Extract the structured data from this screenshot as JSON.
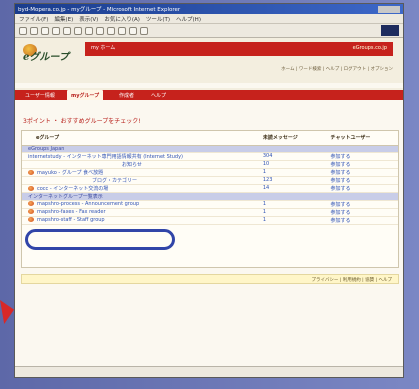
{
  "window": {
    "title": "byd-Mopera.co.jp - myグループ - Microsoft Internet Explorer"
  },
  "menu": [
    "ファイル(F)",
    "編集(E)",
    "表示(V)",
    "お気に入り(A)",
    "ツール(T)",
    "ヘルプ(H)"
  ],
  "header": {
    "logo_text": "eグループ",
    "banner_title": "my ホーム",
    "banner_right": "eGroups.co.jp",
    "crumbs": "ホーム | ワード検索 | ヘルプ | ログアウト | オプション"
  },
  "tabs": [
    "ユーザー情報",
    "myグループ",
    "作成者",
    "ヘルプ"
  ],
  "section": {
    "title": "3ポイント ・ おすすめグループをチェック!",
    "hint": ""
  },
  "table": {
    "headers": [
      "eグループ",
      "未読メッセージ",
      "チャットユーザー"
    ],
    "rows": [
      {
        "type": "group",
        "name": "eGroups Japan",
        "unread": "",
        "chat": ""
      },
      {
        "type": "row",
        "name": "internetstudy - インターネット専門用語情報共有 (Internet Study)",
        "unread": "304",
        "chat": "参加する"
      },
      {
        "type": "row",
        "name": "お知らせ",
        "unread": "10",
        "chat": "参加する"
      },
      {
        "type": "row",
        "name": "mayuko - グループ 食べ放題",
        "unread": "1",
        "chat": "参加する"
      },
      {
        "type": "row",
        "name": "ブログ・カテゴリー",
        "unread": "123",
        "chat": "参加する"
      },
      {
        "type": "row",
        "name": "cocc - インターネット交流の場",
        "unread": "14",
        "chat": "参加する"
      },
      {
        "type": "group",
        "name": "インターネットグループ一覧表示",
        "unread": "",
        "chat": ""
      },
      {
        "type": "row",
        "name": "mapshro-process - Announcement group",
        "unread": "1",
        "chat": "参加する"
      },
      {
        "type": "row",
        "name": "mapshro-faxes - Fax reader",
        "unread": "1",
        "chat": "参加する"
      },
      {
        "type": "row",
        "name": "mapshro-staff - Staff group",
        "unread": "1",
        "chat": "参加する"
      }
    ]
  },
  "footer": {
    "links": "プライバシー | 利用規約 | 協賛 | ヘルプ"
  },
  "colors": {
    "accent": "#c6221c",
    "highlight": "#3145a8",
    "group_row": "#c8cde8"
  }
}
